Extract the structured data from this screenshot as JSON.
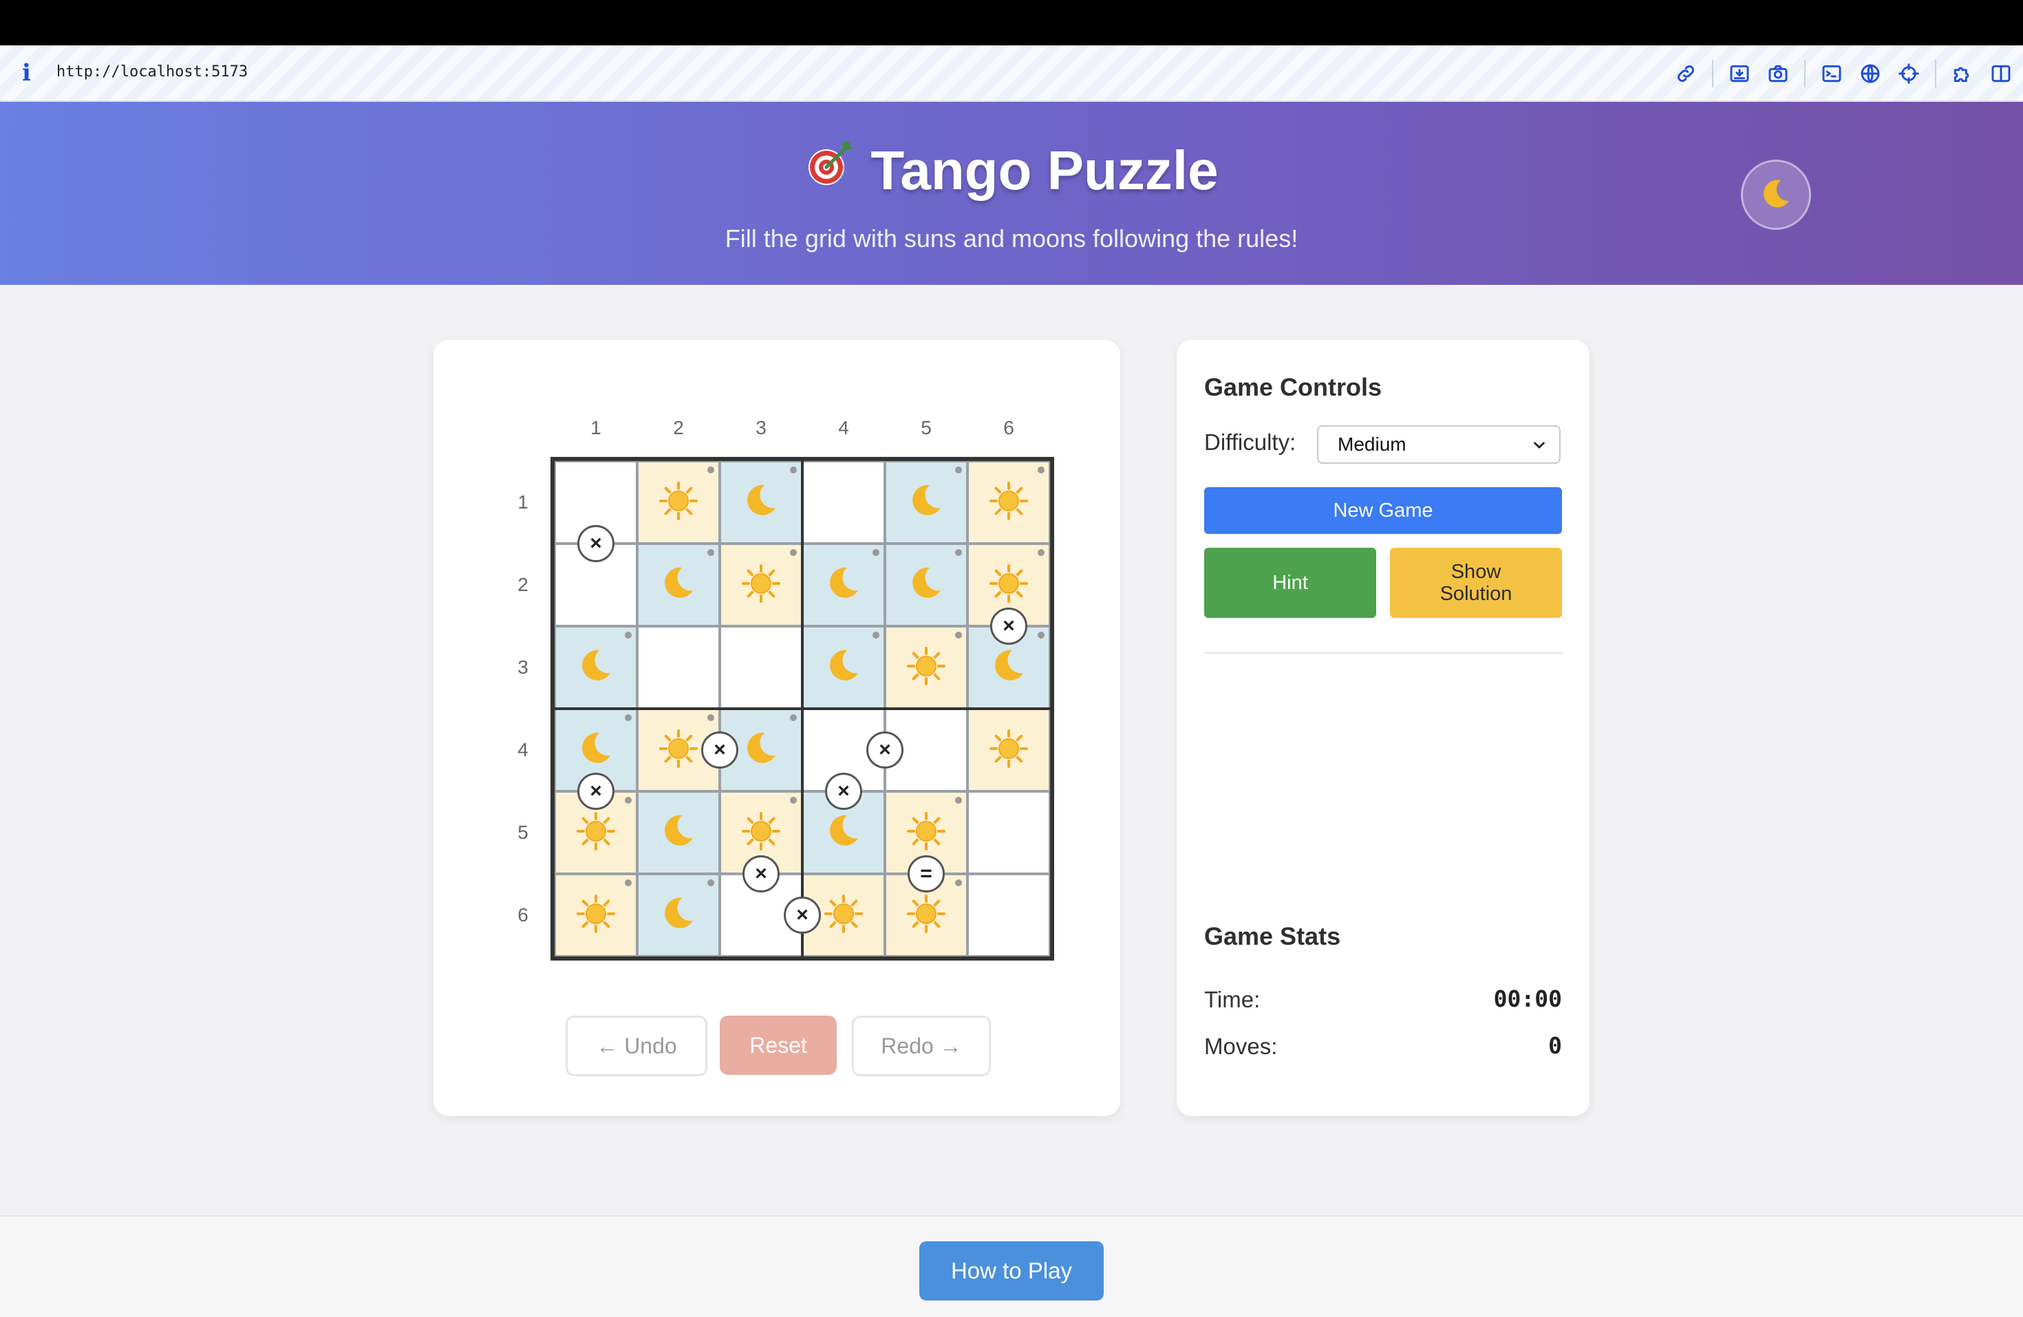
{
  "browser": {
    "info_icon": "i",
    "url": "http://localhost:5173",
    "toolbar_icons": [
      "link-icon",
      "download-icon",
      "camera-icon",
      "terminal-icon",
      "globe-icon",
      "crosshair-icon",
      "puzzle-icon",
      "sidebar-icon"
    ]
  },
  "header": {
    "title": "Tango Puzzle",
    "subtitle": "Fill the grid with suns and moons following the rules!",
    "theme_toggle_icon": "moon-icon"
  },
  "board": {
    "column_labels": [
      "1",
      "2",
      "3",
      "4",
      "5",
      "6"
    ],
    "row_labels": [
      "1",
      "2",
      "3",
      "4",
      "5",
      "6"
    ],
    "cells": [
      [
        "empty",
        "sun",
        "moon",
        "empty",
        "moon",
        "sun"
      ],
      [
        "empty",
        "moon",
        "sun",
        "moon",
        "moon",
        "sun"
      ],
      [
        "moon",
        "empty",
        "empty",
        "moon",
        "sun",
        "moon"
      ],
      [
        "moon",
        "sun",
        "moon",
        "empty",
        "empty",
        "sun"
      ],
      [
        "sun",
        "moon",
        "sun",
        "moon",
        "sun",
        "empty"
      ],
      [
        "sun",
        "moon",
        "empty",
        "sun",
        "sun",
        "empty"
      ]
    ],
    "locked_cells": [
      [
        false,
        true,
        true,
        false,
        true,
        true
      ],
      [
        false,
        true,
        true,
        true,
        true,
        true
      ],
      [
        true,
        false,
        false,
        true,
        true,
        true
      ],
      [
        true,
        true,
        true,
        false,
        false,
        false
      ],
      [
        true,
        false,
        true,
        false,
        true,
        false
      ],
      [
        true,
        true,
        false,
        false,
        true,
        false
      ]
    ],
    "constraints": [
      {
        "symbol": "×",
        "between": "r1c1-r2c1"
      },
      {
        "symbol": "×",
        "between": "r2c6-r3c6"
      },
      {
        "symbol": "×",
        "between": "r4c2-r4c3"
      },
      {
        "symbol": "×",
        "between": "r4c4-r4c5"
      },
      {
        "symbol": "×",
        "between": "r4c1-r5c1"
      },
      {
        "symbol": "×",
        "between": "r4c4-r5c4"
      },
      {
        "symbol": "×",
        "between": "r5c3-r6c3"
      },
      {
        "symbol": "=",
        "between": "r5c5-r6c5"
      },
      {
        "symbol": "×",
        "between": "r6c3-r6c4"
      }
    ],
    "undo_label": "← Undo",
    "reset_label": "Reset",
    "redo_label": "Redo →"
  },
  "controls": {
    "heading": "Game Controls",
    "difficulty_label": "Difficulty:",
    "difficulty_value": "Medium",
    "new_game_label": "New Game",
    "hint_label": "Hint",
    "show_solution_label": "Show Solution"
  },
  "stats": {
    "heading": "Game Stats",
    "time_label": "Time:",
    "time_value": "00:00",
    "moves_label": "Moves:",
    "moves_value": "0"
  },
  "footer": {
    "how_to_play_label": "How to Play"
  },
  "colors": {
    "header_start": "#6a7fe0",
    "header_end": "#7450a6",
    "sun_cell": "#fdf1d3",
    "moon_cell": "#d5e8ee",
    "new_game": "#3b7bf3",
    "hint": "#4ea24e",
    "show_solution": "#f4c243",
    "reset": "#e9ada1",
    "how_to_play": "#4b90dc"
  }
}
